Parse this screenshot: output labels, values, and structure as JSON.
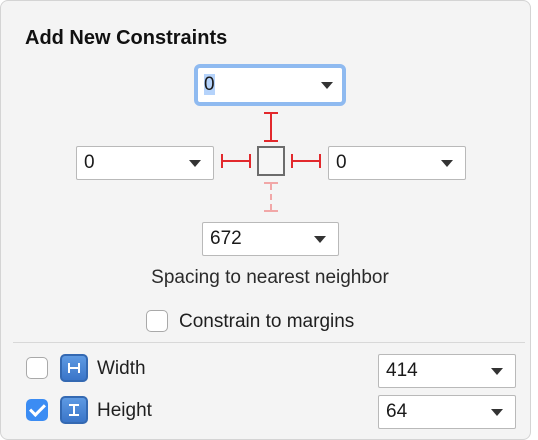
{
  "dialog": {
    "title": "Add New Constraints",
    "spacing_caption": "Spacing to nearest neighbor"
  },
  "spacing": {
    "top": "0",
    "leading": "0",
    "trailing": "0",
    "bottom": "672"
  },
  "margins": {
    "label": "Constrain to margins",
    "checked": false
  },
  "dimensions": [
    {
      "label": "Width",
      "value": "414",
      "checked": false,
      "icon": "width-icon"
    },
    {
      "label": "Height",
      "value": "64",
      "checked": true,
      "icon": "height-icon"
    }
  ],
  "colors": {
    "constraint_active": "#e2282c",
    "constraint_inactive": "#f1a7a7",
    "focus_ring": "#8fbaf0",
    "checkbox_checked": "#3b8cf3",
    "icon_blue": "#3a75c8"
  }
}
